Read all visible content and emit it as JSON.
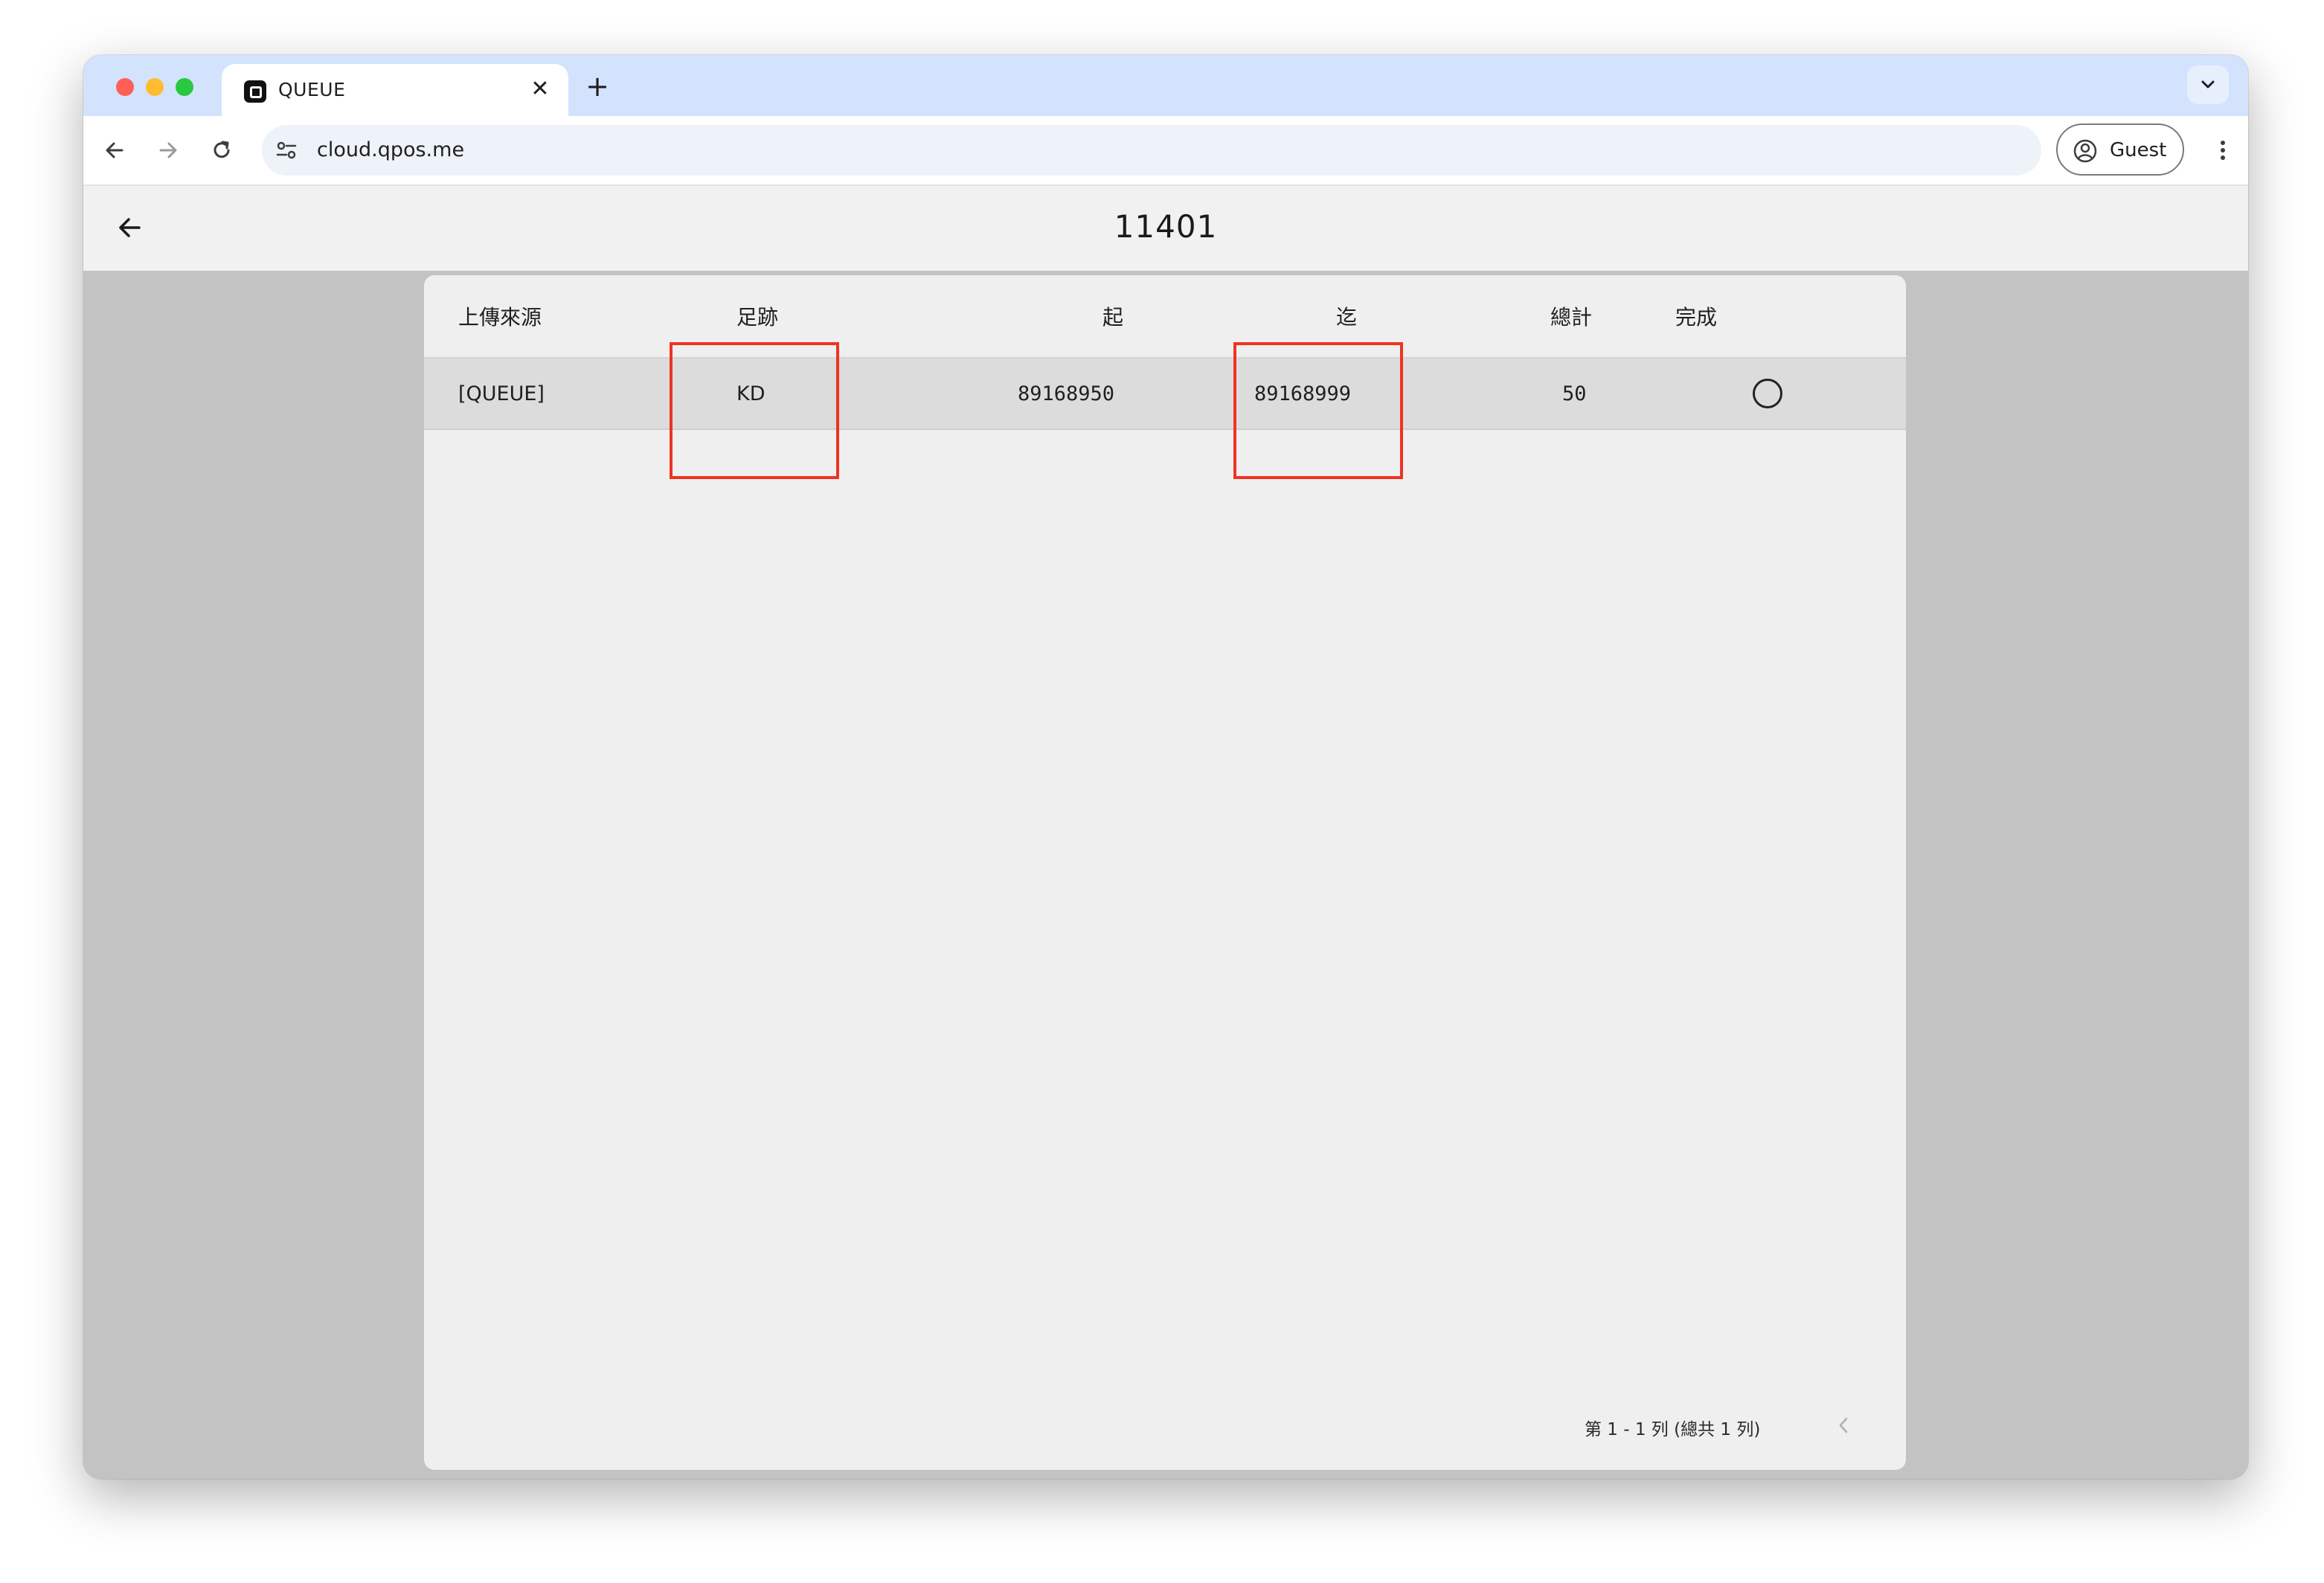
{
  "browser": {
    "tab": {
      "title": "QUEUE",
      "favicon": "queue-logo-icon"
    },
    "address": {
      "url": "cloud.qpos.me"
    },
    "profile": {
      "label": "Guest"
    }
  },
  "page": {
    "title": "11401"
  },
  "table": {
    "columns": {
      "source": "上傳來源",
      "track": "足跡",
      "start": "起",
      "end": "迄",
      "total": "總計",
      "done": "完成"
    },
    "rows": [
      {
        "source": "[QUEUE]",
        "track": "KD",
        "start": "89168950",
        "end": "89168999",
        "total": "50",
        "done": "circle-icon"
      }
    ],
    "highlight_color": "#ee3322"
  },
  "pagination": {
    "summary": "第 1 - 1 列 (總共 1 列)"
  }
}
